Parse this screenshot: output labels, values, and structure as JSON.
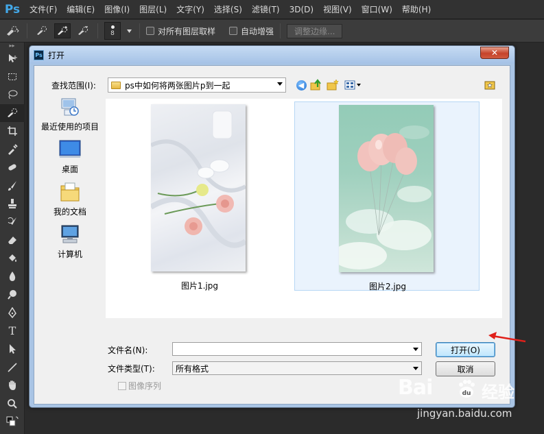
{
  "app": {
    "logo": "Ps"
  },
  "menu": [
    "文件(F)",
    "编辑(E)",
    "图像(I)",
    "图层(L)",
    "文字(Y)",
    "选择(S)",
    "滤镜(T)",
    "3D(D)",
    "视图(V)",
    "窗口(W)",
    "帮助(H)"
  ],
  "options_bar": {
    "brush_size": "8",
    "sample_all_layers_label": "对所有图层取样",
    "auto_enhance_label": "自动增强",
    "refine_edge_label": "调整边缘..."
  },
  "dialog": {
    "title": "打开",
    "close_glyph": "✕",
    "look_in_label": "查找范围(I):",
    "look_in_value": "ps中如何将两张图片p到一起",
    "places": [
      "最近使用的项目",
      "桌面",
      "我的文档",
      "计算机"
    ],
    "files": [
      {
        "name": "图片1.jpg",
        "selected": false
      },
      {
        "name": "图片2.jpg",
        "selected": true
      }
    ],
    "file_name_label": "文件名(N):",
    "file_name_value": "",
    "file_type_label": "文件类型(T):",
    "file_type_value": "所有格式",
    "open_button": "打开(O)",
    "cancel_button": "取消",
    "image_sequence_label": "图像序列"
  },
  "colors": {
    "accent_arrow": "#e0201a",
    "dialog_frame": "#a9c4e4",
    "ps_blue": "#43a8e8"
  },
  "icons": [
    "back-icon",
    "up-folder-icon",
    "new-folder-icon",
    "view-menu-icon",
    "favorite-folder-icon",
    "recent-items-icon",
    "desktop-icon",
    "documents-icon",
    "computer-icon"
  ],
  "watermark": {
    "brand": "Bai",
    "brand_cn": "经验",
    "paw": "du",
    "url": "jingyan.baidu.com"
  }
}
